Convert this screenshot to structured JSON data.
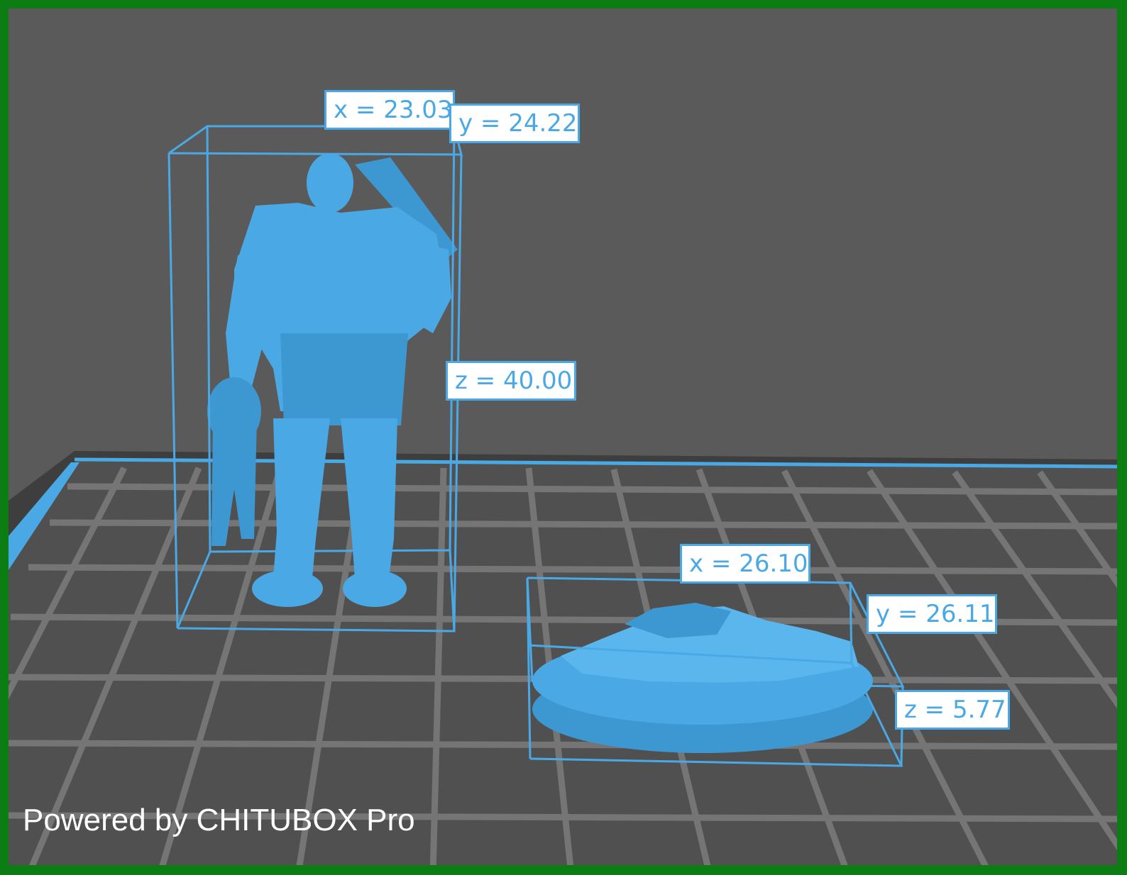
{
  "watermark": "Powered by CHITUBOX Pro",
  "models": [
    {
      "name": "warrior-miniature",
      "dims": {
        "x": "x = 23.03",
        "y": "y = 24.22",
        "z": "z = 40.00"
      }
    },
    {
      "name": "scenic-base",
      "dims": {
        "x": "x = 26.10",
        "y": "y = 26.11",
        "z": "z = 5.77"
      }
    }
  ],
  "colors": {
    "background": "#5a5a5a",
    "plate": "#505050",
    "grid": "#7a7a7a",
    "accent": "#4aa9e5",
    "model": "#4aa9e5",
    "frame": "#0b7d12"
  }
}
